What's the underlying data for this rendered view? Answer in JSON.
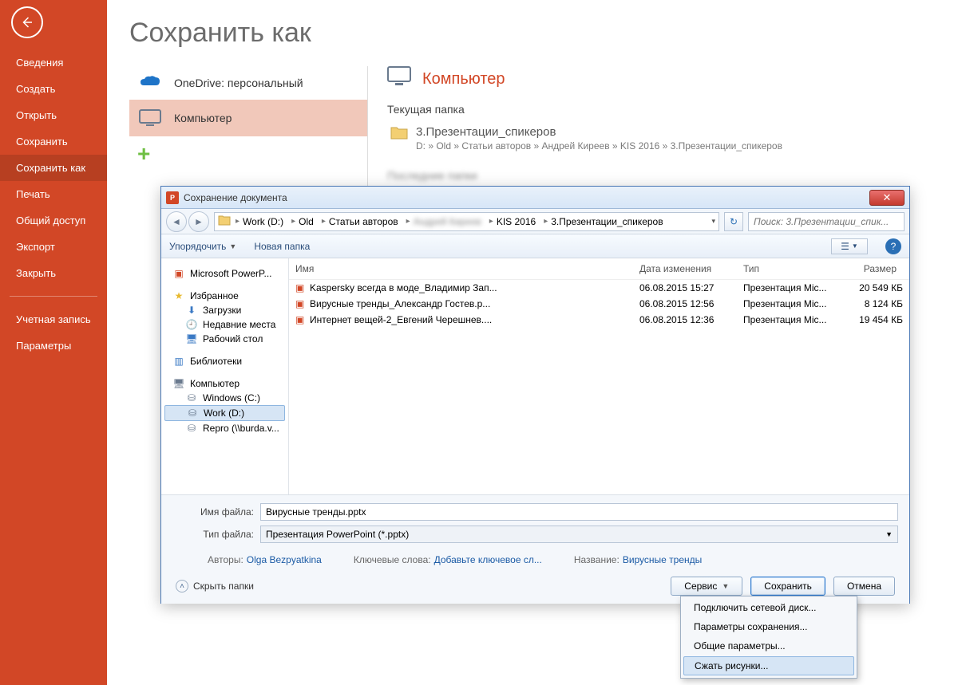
{
  "sidebar": {
    "items": [
      {
        "label": "Сведения"
      },
      {
        "label": "Создать"
      },
      {
        "label": "Открыть"
      },
      {
        "label": "Сохранить"
      },
      {
        "label": "Сохранить как",
        "selected": true
      },
      {
        "label": "Печать"
      },
      {
        "label": "Общий доступ"
      },
      {
        "label": "Экспорт"
      },
      {
        "label": "Закрыть"
      }
    ],
    "extra": [
      {
        "label": "Учетная запись"
      },
      {
        "label": "Параметры"
      }
    ]
  },
  "page": {
    "title": "Сохранить как",
    "places": [
      {
        "label": "OneDrive: персональный",
        "icon": "onedrive"
      },
      {
        "label": "Компьютер",
        "icon": "computer",
        "selected": true
      }
    ],
    "computer_heading": "Компьютер",
    "current_folder_label": "Текущая папка",
    "current_folder_name": "3.Презентации_спикеров",
    "current_folder_path": "D: » Old » Статьи авторов » Андрей Киреев » KIS 2016 » 3.Презентации_спикеров",
    "recent_label": "Последние папки"
  },
  "dialog": {
    "title": "Сохранение документа",
    "breadcrumb": [
      "Work (D:)",
      "Old",
      "Статьи авторов",
      "Андрей Киреев",
      "KIS 2016",
      "3.Презентации_спикеров"
    ],
    "search_placeholder": "Поиск: 3.Презентации_спик...",
    "toolbar": {
      "organize": "Упорядочить",
      "new_folder": "Новая папка"
    },
    "tree": {
      "top": "Microsoft PowerP...",
      "fav": "Избранное",
      "fav_items": [
        "Загрузки",
        "Недавние места",
        "Рабочий стол"
      ],
      "libs": "Библиотеки",
      "comp": "Компьютер",
      "comp_items": [
        "Windows (C:)",
        "Work (D:)",
        "Repro (\\\\burda.v..."
      ],
      "selected": "Work (D:)"
    },
    "columns": {
      "name": "Имя",
      "date": "Дата изменения",
      "type": "Тип",
      "size": "Размер"
    },
    "files": [
      {
        "name": "Kaspersky всегда в моде_Владимир Зап...",
        "date": "06.08.2015 15:27",
        "type": "Презентация Mic...",
        "size": "20 549 КБ"
      },
      {
        "name": "Вирусные тренды_Александр Гостев.p...",
        "date": "06.08.2015 12:56",
        "type": "Презентация Mic...",
        "size": "8 124 КБ"
      },
      {
        "name": "Интернет вещей-2_Евгений Черешнев....",
        "date": "06.08.2015 12:36",
        "type": "Презентация Mic...",
        "size": "19 454 КБ"
      }
    ],
    "filename_label": "Имя файла:",
    "filename_value": "Вирусные тренды.pptx",
    "filetype_label": "Тип файла:",
    "filetype_value": "Презентация PowerPoint (*.pptx)",
    "meta": {
      "authors_label": "Авторы:",
      "authors_value": "Olga Bezpyatkina",
      "keywords_label": "Ключевые слова:",
      "keywords_value": "Добавьте ключевое сл...",
      "title_label": "Название:",
      "title_value": "Вирусные тренды"
    },
    "hide_folders": "Скрыть папки",
    "buttons": {
      "tools": "Сервис",
      "save": "Сохранить",
      "cancel": "Отмена"
    },
    "tools_menu": [
      "Подключить сетевой диск...",
      "Параметры сохранения...",
      "Общие параметры...",
      "Сжать рисунки..."
    ]
  }
}
